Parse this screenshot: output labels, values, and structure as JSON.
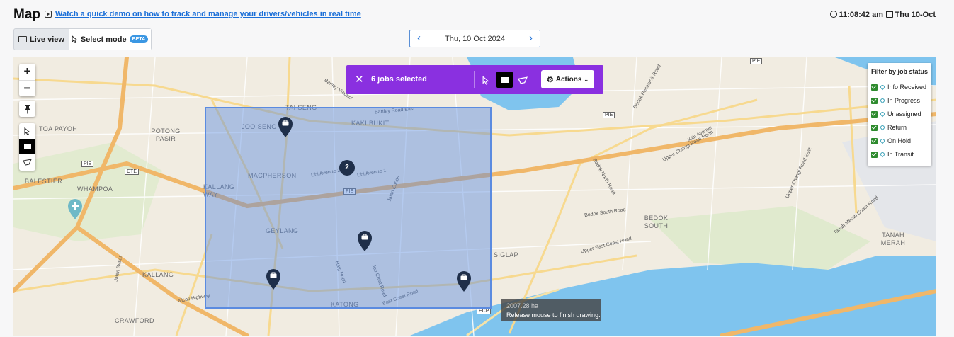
{
  "header": {
    "title": "Map",
    "demo_link": "Watch a quick demo on how to track and manage your drivers/vehicles in real time",
    "time": "11:08:42 am",
    "date": "Thu 10-Oct"
  },
  "mode_toggle": {
    "live_label": "Live view",
    "select_label": "Select mode",
    "beta_badge": "BETA",
    "active": "Select mode"
  },
  "date_nav": {
    "date": "Thu, 10 Oct 2024",
    "prev_icon": "chevron-left-icon",
    "next_icon": "chevron-right-icon"
  },
  "map_controls": {
    "zoom_in": "+",
    "zoom_out": "−",
    "icons": [
      "zoom-in-icon",
      "zoom-out-icon",
      "pushpin-icon",
      "pointer-icon",
      "rectangle-select-icon",
      "lasso-icon"
    ]
  },
  "selection_bar": {
    "count_label": "6 jobs selected",
    "actions_label": "Actions",
    "color": "#8a30e0"
  },
  "filter": {
    "title": "Filter by job status",
    "items": [
      {
        "label": "Info Received",
        "checked": true
      },
      {
        "label": "In Progress",
        "checked": true
      },
      {
        "label": "Unassigned",
        "checked": true
      },
      {
        "label": "Return",
        "checked": true
      },
      {
        "label": "On Hold",
        "checked": true
      },
      {
        "label": "In Transit",
        "checked": true
      }
    ]
  },
  "drawing_tooltip": {
    "area": "2007.28 ha",
    "hint": "Release mouse to finish drawing."
  },
  "markers": {
    "cluster_count": "2",
    "job_marker_count": 4
  },
  "map_labels": {
    "places": [
      "TOA PAYOH",
      "POTONG PASIR",
      "BALESTIER",
      "WHAMPOA",
      "KALLANG WAY",
      "MACPHERSON",
      "GEYLANG",
      "KALLANG",
      "CRAWFORD",
      "KATONG",
      "JOO SENG",
      "KAKI BUKIT",
      "TAI SENG",
      "BEDOK SOUTH",
      "SIGLAP",
      "TANAH MERAH"
    ],
    "roads": [
      "Bartley Viaduct",
      "Bartley Road East",
      "Ubi Avenue 2",
      "Ubi Avenue 1",
      "Jalan Eunos",
      "Upper Changi Road North",
      "Bedok South Road",
      "Upper East Coast Road",
      "East Coast Road",
      "Nicoll Highway",
      "Haig Road",
      "Joo Chiat Road",
      "Upper Changi Road East",
      "Bedok Reservoir Road",
      "Tanah Merah Coast Road",
      "Bedok North Road",
      "Xilin Avenue",
      "Jalan Besar"
    ],
    "shields": [
      "PIE",
      "PIE",
      "CTE",
      "PIE",
      "PIE",
      "ECP"
    ]
  },
  "colors": {
    "selection_fill": "#5b8be0",
    "water": "#7fc4ee",
    "expressway": "#f0b769",
    "link": "#1b6fd8",
    "marker": "#1f2f4a",
    "checkbox": "#2e8b2e"
  }
}
